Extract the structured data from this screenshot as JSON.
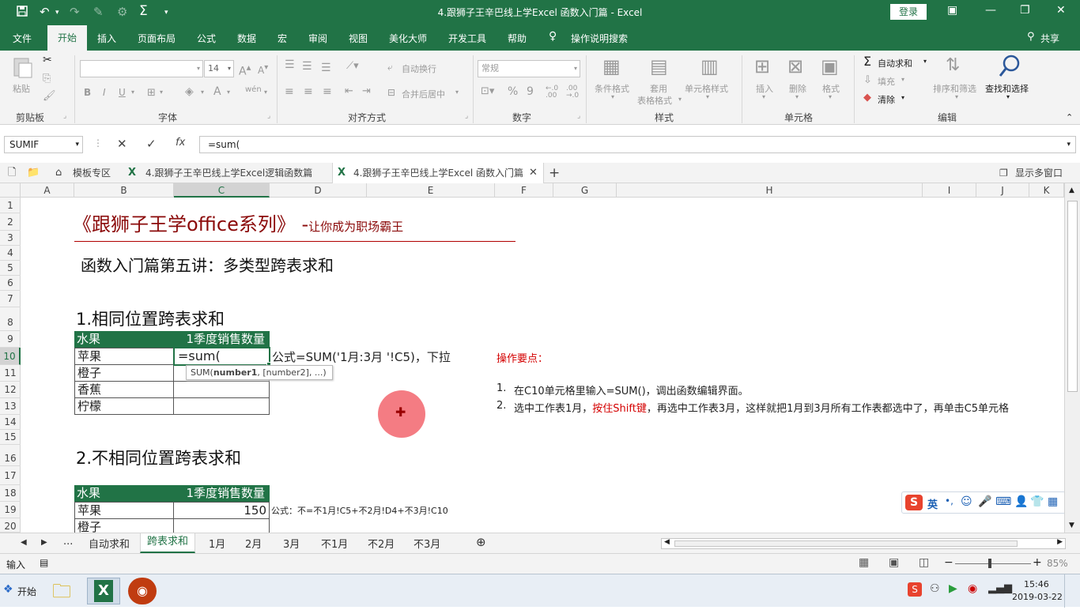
{
  "window": {
    "title": "4.跟狮子王辛巴线上学Excel 函数入门篇  -  Excel",
    "login_label": "登录"
  },
  "ribbon_tabs": [
    "文件",
    "开始",
    "插入",
    "页面布局",
    "公式",
    "数据",
    "宏",
    "审阅",
    "视图",
    "美化大师",
    "开发工具",
    "帮助",
    "操作说明搜索"
  ],
  "share_label": "共享",
  "ribbon": {
    "clipboard": {
      "paste": "粘贴",
      "label": "剪贴板"
    },
    "font": {
      "size": "14",
      "bold": "B",
      "italic": "I",
      "underline": "U",
      "label": "字体",
      "wen": "wén"
    },
    "alignment": {
      "wrap": "自动换行",
      "merge": "合并后居中",
      "label": "对齐方式"
    },
    "number": {
      "format": "常规",
      "label": "数字",
      "percent": "%",
      "comma": "9",
      "inc": "←.0 .00",
      "dec": ".00 →.0"
    },
    "styles": {
      "cond": "条件格式",
      "table1": "套用",
      "table2": "表格格式",
      "cell": "单元格样式",
      "label": "样式"
    },
    "cells": {
      "insert": "插入",
      "delete": "删除",
      "format": "格式",
      "label": "单元格"
    },
    "editing": {
      "autosum": "自动求和",
      "fill": "填充",
      "clear": "清除",
      "sort": "排序和筛选",
      "find": "查找和选择",
      "label": "编辑"
    }
  },
  "formula_bar": {
    "name_box": "SUMIF",
    "formula": "=sum("
  },
  "doc_tabs": {
    "template": "模板专区",
    "tab1": "4.跟狮子王辛巴线上学Excel逻辑函数篇",
    "tab2": "4.跟狮子王辛巴线上学Excel 函数入门篇",
    "multi": "显示多窗口"
  },
  "columns": [
    "A",
    "B",
    "C",
    "D",
    "E",
    "F",
    "G",
    "H",
    "I",
    "J",
    "K"
  ],
  "rows": [
    "1",
    "2",
    "3",
    "4",
    "5",
    "6",
    "7",
    "8",
    "9",
    "10",
    "11",
    "12",
    "13",
    "14",
    "15",
    "16",
    "17",
    "18",
    "19",
    "20"
  ],
  "sheet": {
    "main_title": "《跟狮子王学office系列》",
    "main_dash": "-",
    "main_sub": "让你成为职场霸王",
    "lesson": "函数入门篇第五讲：多类型跨表求和",
    "section1": "1.相同位置跨表求和",
    "section2": "2.不相同位置跨表求和",
    "table1": {
      "h1": "水果",
      "h2": "1季度销售数量",
      "fruits": [
        "苹果",
        "橙子",
        "香蕉",
        "柠檬"
      ],
      "editing": "=sum(",
      "tooltip_fn": "SUM(",
      "tooltip_arg1": "number1",
      "tooltip_rest": ", [number2], ...)"
    },
    "note1": "公式=SUM('1月:3月 '!C5)，下拉",
    "ops_title": "操作要点：",
    "step1_num": "1.",
    "step1": "在C10单元格里输入=SUM()，调出函数编辑界面。",
    "step2_num": "2.",
    "step2_a": "选中工作表1月，",
    "step2_b": "按住Shift键",
    "step2_c": "，再选中工作表3月，这样就把1月到3月所有工作表都选中了，再单击C5单元格",
    "table2": {
      "h1": "水果",
      "h2": "1季度销售数量",
      "fruits": [
        "苹果",
        "橙子"
      ],
      "value": "150"
    },
    "note2": "公式：不=不1月!C5+不2月!D4+不3月!C10"
  },
  "sheet_tabs": [
    "...",
    "自动求和",
    "跨表求和",
    "1月",
    "2月",
    "3月",
    "不1月",
    "不2月",
    "不3月"
  ],
  "status": {
    "mode": "输入",
    "zoom": "85%"
  },
  "ime": {
    "lang": "英"
  },
  "taskbar": {
    "start": "开始",
    "time": "15:46",
    "date": "2019-03-22"
  },
  "colors": {
    "excel_green": "#217346",
    "dark_red": "#8b0a0a",
    "red": "#d40000"
  }
}
